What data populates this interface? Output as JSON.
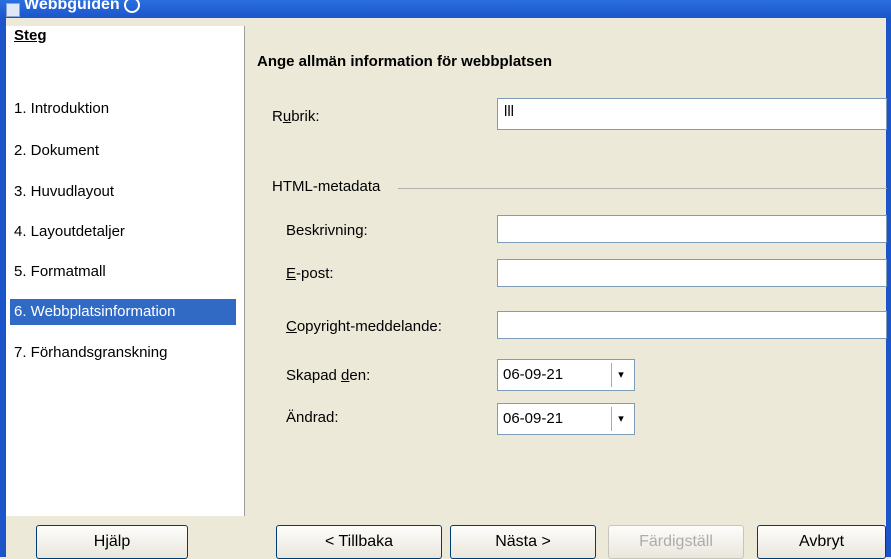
{
  "window": {
    "title": "Webbguiden"
  },
  "sidebar": {
    "header": "Steg",
    "items": [
      {
        "label": "1. Introduktion"
      },
      {
        "label": "2. Dokument"
      },
      {
        "label": "3. Huvudlayout"
      },
      {
        "label": "4. Layoutdetaljer"
      },
      {
        "label": "5. Formatmall"
      },
      {
        "label": "6. Webbplatsinformation"
      },
      {
        "label": "7. Förhandsgranskning"
      }
    ],
    "active_index": 5
  },
  "main": {
    "title": "Ange allmän information för webbplatsen",
    "rubrik": {
      "label_pre": "R",
      "label_u": "u",
      "label_post": "brik:",
      "value": "lll"
    },
    "metadata_group": "HTML-metadata",
    "beskrivning": {
      "label": "Beskrivning:",
      "value": ""
    },
    "epost": {
      "label_u": "E",
      "label_post": "-post:",
      "value": ""
    },
    "copyright": {
      "label_u": "C",
      "label_post": "opyright-meddelande:",
      "value": ""
    },
    "skapad": {
      "label_pre": "Skapad ",
      "label_u": "d",
      "label_post": "en:",
      "value": "06-09-21"
    },
    "andrad": {
      "label": "Ändrad:",
      "value": "06-09-21"
    }
  },
  "buttons": {
    "help": "Hjälp",
    "back": "< Tillbaka",
    "next": "Nästa >",
    "finish": "Färdigställ",
    "cancel": "Avbryt"
  }
}
